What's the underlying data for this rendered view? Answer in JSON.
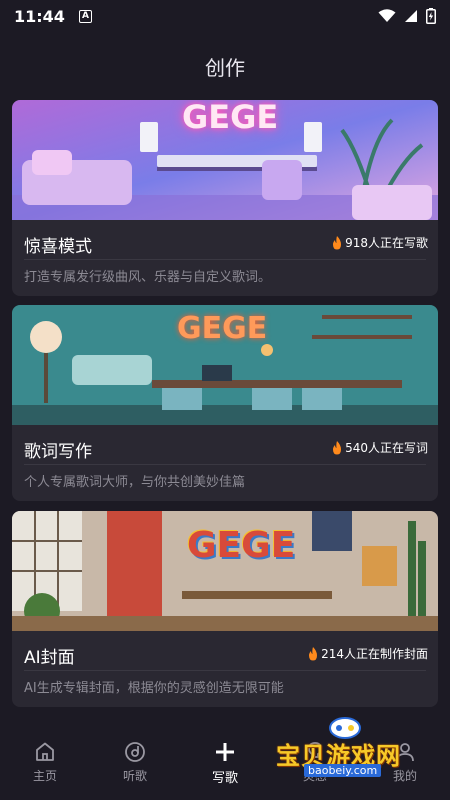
{
  "status": {
    "time": "11:44",
    "badge": "A"
  },
  "header": {
    "title": "创作"
  },
  "cards": [
    {
      "title": "惊喜模式",
      "count": "918人正在写歌",
      "desc": "打造专属发行级曲风、乐器与自定义歌词。",
      "sign": "GEGE"
    },
    {
      "title": "歌词写作",
      "count": "540人正在写词",
      "desc": "个人专属歌词大师，与你共创美妙佳篇",
      "sign": "GEGE"
    },
    {
      "title": "AI封面",
      "count": "214人正在制作封面",
      "desc": "AI生成专辑封面，根据你的灵感创造无限可能",
      "sign": "GEGE"
    }
  ],
  "nav": {
    "items": [
      {
        "label": "主页",
        "icon": "home-icon"
      },
      {
        "label": "听歌",
        "icon": "disc-icon"
      },
      {
        "label": "写歌",
        "icon": "plus-icon"
      },
      {
        "label": "灵感",
        "icon": "bulb-icon"
      },
      {
        "label": "我的",
        "icon": "user-icon"
      }
    ]
  },
  "watermark": {
    "text": "宝贝游戏网",
    "url": "baobeiy.com"
  },
  "colors": {
    "background": "#1c1a24",
    "card": "#2a2832",
    "accent_fire": "#ff8a1c",
    "watermark": "#f7c928"
  }
}
